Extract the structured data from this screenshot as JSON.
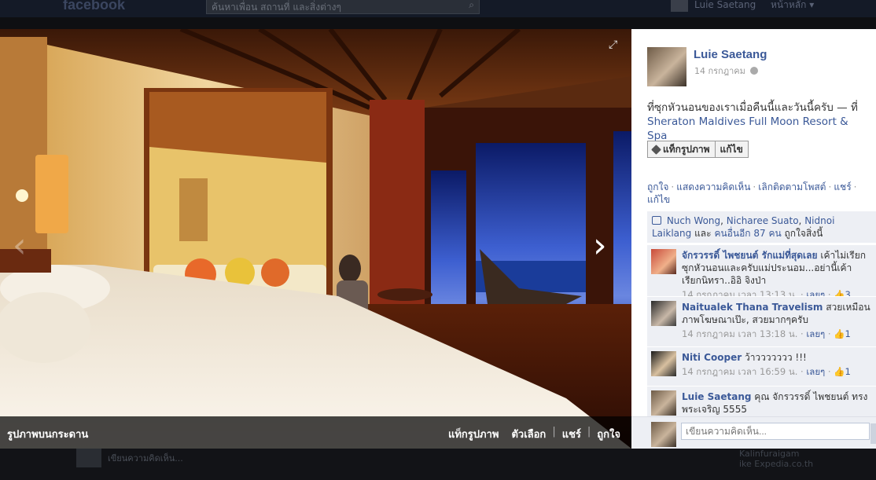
{
  "header": {
    "logo": "facebook",
    "search_placeholder": "ค้นหาเพื่อน สถานที่ และสิ่งต่างๆ",
    "user_name": "Luie Saetang",
    "home_label": "หน้าหลัก"
  },
  "background": {
    "comment_placeholder": "เขียนความคิดเห็น...",
    "right_text_1": "Kalinfuraigam",
    "right_text_2": "ike Expedia.co.th"
  },
  "photo": {
    "album_label": "รูปภาพบนกระดาน",
    "actions": [
      "แท็กรูปภาพ",
      "ตัวเลือก",
      "แชร์",
      "ถูกใจ"
    ]
  },
  "post": {
    "author": "Luie Saetang",
    "date": "14 กรกฎาคม",
    "text": "ที่ซุกหัวนอนของเราเมื่อคืนนี้และวันนี้ครับ — ที่",
    "place": "Sheraton Maldives Full Moon Resort & Spa",
    "tag_button": "แท็กรูปภาพ",
    "edit_button": "แก้ไข",
    "links": [
      "ถูกใจ",
      "แสดงความคิดเห็น",
      "เลิกติดตามโพสต์",
      "แชร์",
      "แก้ไข"
    ]
  },
  "likes": {
    "names": [
      "Nuch Wong",
      "Nicharee Suato",
      "Nidnoi Laiklang"
    ],
    "and_label": "และ",
    "others": "คนอื่นอีก 87 คน",
    "suffix": "ถูกใจสิ่งนี้"
  },
  "comments": [
    {
      "author": "จักรวรรดิ์ ไพชยนต์ รักแม่ที่สุดเลย",
      "text": "เค้าไม่เรียกซุกหัวนอนและครับแม่ประนอม...อย่านี้เค้าเรียกนิทรา..อิอิ จิงป่า",
      "time": "14 กรกฎาคม เวลา 13:13 น.",
      "unlike": "เลยๆ",
      "likes": "3"
    },
    {
      "author": "Naitualek Thana Travelism",
      "text": "สวยเหมือนภาพโฆษณาเป๊ะ, สวยมากๆครับ",
      "time": "14 กรกฎาคม เวลา 13:18 น.",
      "unlike": "เลยๆ",
      "likes": "1"
    },
    {
      "author": "Niti Cooper",
      "text": "ว้าววววววว !!!",
      "time": "14 กรกฎาคม เวลา 16:59 น.",
      "unlike": "เลยๆ",
      "likes": "1"
    },
    {
      "author": "Luie Saetang",
      "text": "คุณ จักรวรรดิ์ ไพชยนต์ ทรงพระเจริญ 5555",
      "time": "",
      "unlike": "",
      "likes": ""
    }
  ],
  "reply": {
    "placeholder": "เขียนความคิดเห็น..."
  }
}
